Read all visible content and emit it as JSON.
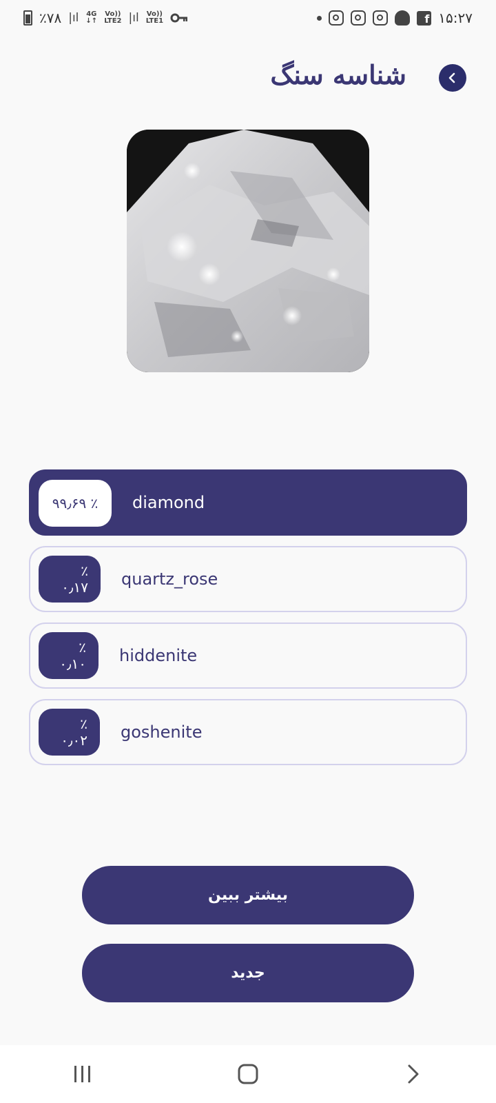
{
  "status_bar": {
    "battery_text": "٪۷۸",
    "net1": "4G",
    "lte2": "LTE2",
    "lte1": "LTE1",
    "volte": "Vo))",
    "time": "۱۵:۲۷",
    "icons": [
      "instagram-icon",
      "instagram-icon",
      "instagram-icon",
      "snapchat-icon",
      "facebook-icon",
      "key-icon",
      "battery-icon",
      "signal-icon"
    ]
  },
  "header": {
    "title": "شناسه سنگ",
    "back_icon": "chevron-left-icon"
  },
  "results": [
    {
      "percent": "٪ ۹۹٫۶۹",
      "name": "diamond",
      "top": true
    },
    {
      "percent": "٪ ۰٫۱۷",
      "name": "quartz_rose",
      "top": false
    },
    {
      "percent": "٪ ۰٫۱۰",
      "name": "hiddenite",
      "top": false
    },
    {
      "percent": "٪ ۰٫۰۲",
      "name": "goshenite",
      "top": false
    }
  ],
  "buttons": {
    "see_more": "بیشتر ببین",
    "new": "جدید"
  },
  "nav": {
    "recents": "recents-icon",
    "home": "home-icon",
    "back": "back-icon"
  },
  "colors": {
    "accent": "#3b3774",
    "outline": "#d3d1ec",
    "background": "#f9f9f9"
  }
}
